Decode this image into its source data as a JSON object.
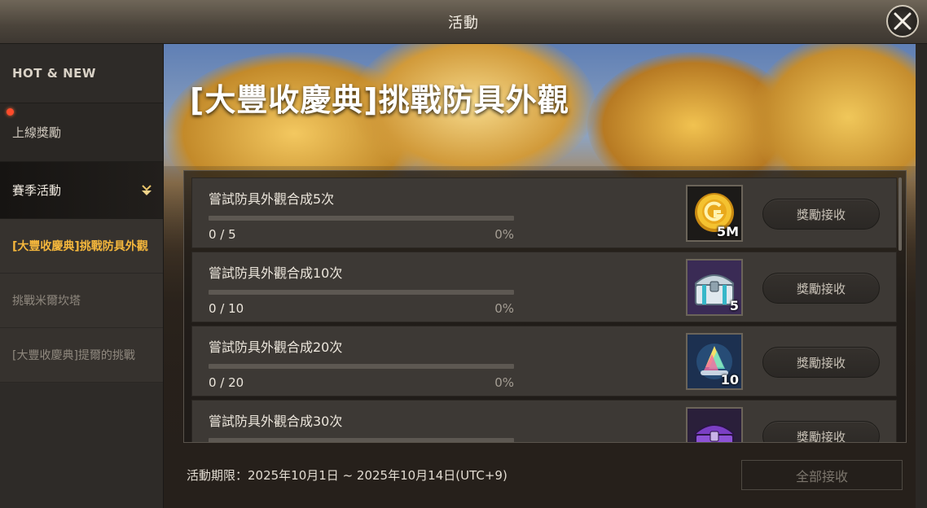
{
  "window": {
    "title": "活動"
  },
  "sidebar": {
    "hot_new": "HOT & NEW",
    "login_reward": "上線獎勵",
    "season": "賽季活動",
    "sub_items": [
      "[大豐收慶典]挑戰防具外觀",
      "挑戰米爾坎塔",
      "[大豐收慶典]提爾的挑戰"
    ]
  },
  "event": {
    "title": "[大豐收慶典]挑戰防具外觀",
    "period": "活動期限：2025年10月1日 ~ 2025年10月14日(UTC+9)",
    "claim_all_label": "全部接收"
  },
  "missions": [
    {
      "title": "嘗試防具外觀合成5次",
      "progress": "0 / 5",
      "percent": "0%",
      "fraction": 0,
      "reward_icon": "gold-coin-icon",
      "reward_qty": "5M",
      "claim_label": "獎勵接收"
    },
    {
      "title": "嘗試防具外觀合成10次",
      "progress": "0 / 10",
      "percent": "0%",
      "fraction": 0,
      "reward_icon": "silver-chest-icon",
      "reward_qty": "5",
      "claim_label": "獎勵接收"
    },
    {
      "title": "嘗試防具外觀合成20次",
      "progress": "0 / 20",
      "percent": "0%",
      "fraction": 0,
      "reward_icon": "crystal-icon",
      "reward_qty": "10",
      "claim_label": "獎勵接收"
    },
    {
      "title": "嘗試防具外觀合成30次",
      "progress": "",
      "percent": "",
      "fraction": 0,
      "reward_icon": "purple-chest-icon",
      "reward_qty": "",
      "claim_label": "獎勵接收"
    }
  ]
}
